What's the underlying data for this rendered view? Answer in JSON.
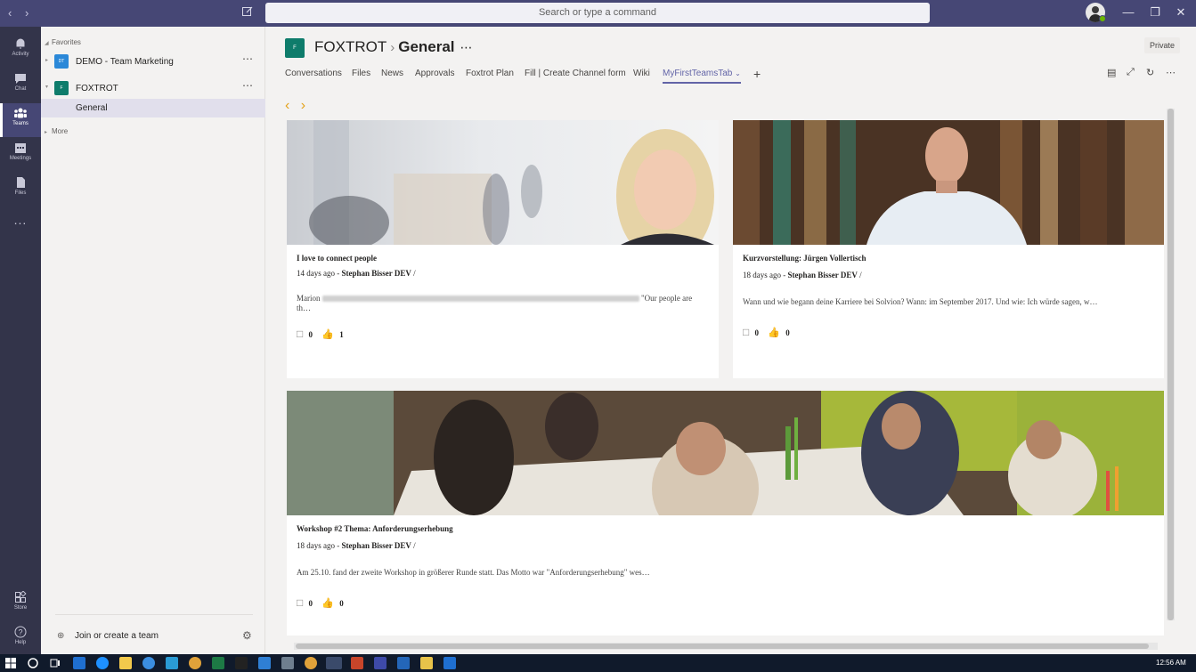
{
  "titlebar": {
    "search_placeholder": "Search or type a command"
  },
  "rail": [
    {
      "label": "Activity",
      "icon": "bell-icon"
    },
    {
      "label": "Chat",
      "icon": "chat-icon"
    },
    {
      "label": "Teams",
      "icon": "teams-icon",
      "active": true
    },
    {
      "label": "Meetings",
      "icon": "calendar-icon"
    },
    {
      "label": "Files",
      "icon": "file-icon"
    },
    {
      "label": "...",
      "icon": "more-apps-icon"
    },
    {
      "label": "Store",
      "icon": "store-icon"
    },
    {
      "label": "Help",
      "icon": "help-icon"
    }
  ],
  "sidebar": {
    "favorites_label": "Favorites",
    "teams": [
      {
        "name": "DEMO - Team Marketing",
        "initials": "DT",
        "color": "#2b88d8"
      },
      {
        "name": "FOXTROT",
        "initials": "F",
        "color": "#0e7c6b"
      }
    ],
    "channel": "General",
    "more_label": "More",
    "join_label": "Join or create a team"
  },
  "header": {
    "team_initial": "F",
    "team": "FOXTROT",
    "channel": "General",
    "privacy": "Private",
    "tabs": [
      "Conversations",
      "Files",
      "News",
      "Approvals",
      "Foxtrot Plan",
      "Fill | Create Channel form",
      "Wiki",
      "MyFirstTeamsTab"
    ],
    "active_tab": "MyFirstTeamsTab"
  },
  "cards": [
    {
      "title": "I love to connect people",
      "age": "14 days ago - ",
      "author": "Stephan Bisser DEV",
      "author_suffix": " /",
      "excerpt_start": "Marion",
      "excerpt_end": " \"Our people are th…",
      "comments": "0",
      "likes": "1"
    },
    {
      "title": "Kurzvorstellung: Jürgen Vollertisch",
      "age": "18 days ago - ",
      "author": "Stephan Bisser DEV",
      "author_suffix": " /",
      "excerpt": "Wann und wie begann deine Karriere bei Solvion? Wann: im September 2017. Und wie: Ich würde sagen, w…",
      "comments": "0",
      "likes": "0"
    },
    {
      "title": "Workshop #2 Thema: Anforderungserhebung",
      "age": "18 days ago - ",
      "author": "Stephan Bisser DEV",
      "author_suffix": " /",
      "excerpt": "Am 25.10. fand der zweite Workshop in größerer Runde statt. Das Motto war \"Anforderungserhebung\" wes…",
      "comments": "0",
      "likes": "0"
    }
  ],
  "taskbar": {
    "time": "12:56 AM"
  }
}
